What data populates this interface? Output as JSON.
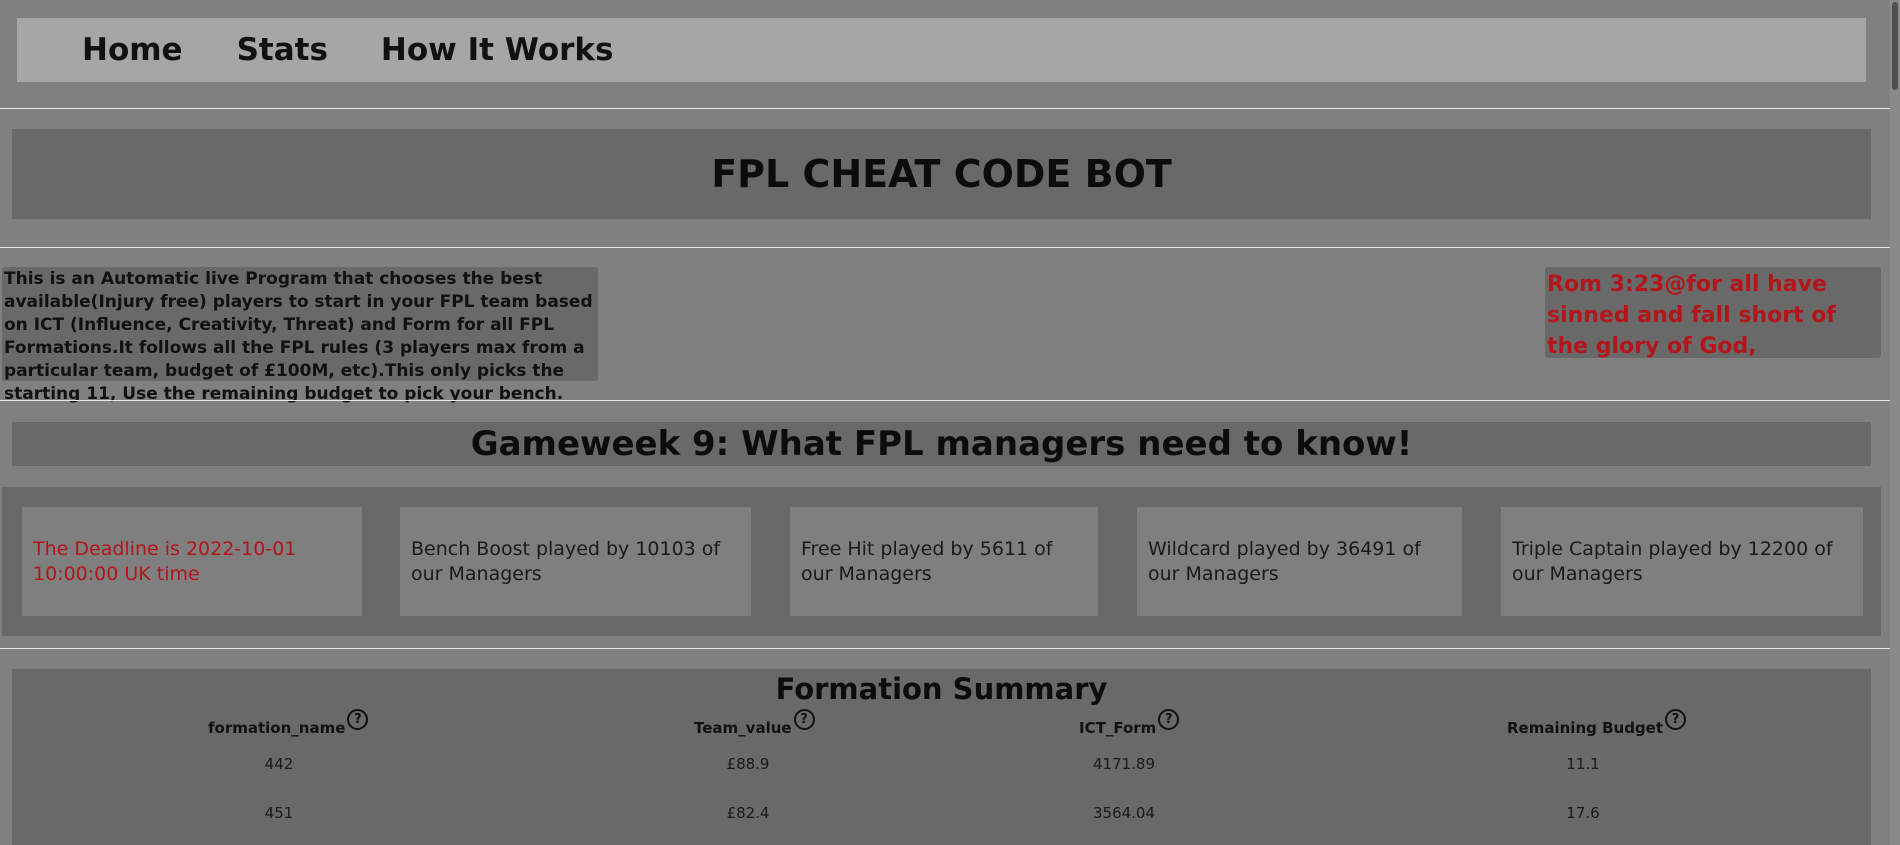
{
  "nav": {
    "items": [
      {
        "label": "Home"
      },
      {
        "label": "Stats"
      },
      {
        "label": "How It Works"
      }
    ]
  },
  "header": {
    "title": "FPL CHEAT CODE BOT"
  },
  "intro": {
    "description": "This is an Automatic live Program that chooses the best available(Injury free) players to start in your FPL team based on ICT (Influence, Creativity, Threat) and Form for all FPL Formations.It follows all the FPL rules (3 players max from a particular team, budget of £100M, etc).This only picks the starting 11, Use the remaining budget to pick your bench.",
    "verse": "Rom 3:23@for all have sinned and fall short of the glory of God,"
  },
  "gameweek": {
    "title": "Gameweek 9: What FPL managers need to know!",
    "cards": [
      {
        "text": "The Deadline is 2022-10-01 10:00:00 UK time"
      },
      {
        "text": "Bench Boost played by 10103 of our Managers"
      },
      {
        "text": "Free Hit played by 5611 of our Managers"
      },
      {
        "text": "Wildcard played by 36491 of our Managers"
      },
      {
        "text": "Triple Captain played by 12200 of our Managers"
      }
    ]
  },
  "formation_summary": {
    "title": "Formation Summary",
    "help_glyph": "?",
    "columns": [
      "formation_name",
      "Team_value",
      "ICT_Form",
      "Remaining Budget"
    ],
    "rows": [
      [
        "442",
        "£88.9",
        "4171.89",
        "11.1"
      ],
      [
        "451",
        "£82.4",
        "3564.04",
        "17.6"
      ]
    ]
  },
  "colors": {
    "page_bg": "#808080",
    "panel_bg": "#696969",
    "nav_bg": "#a6a6a6",
    "card_bg": "#7f7f7f",
    "alert_red": "#b3151a"
  }
}
